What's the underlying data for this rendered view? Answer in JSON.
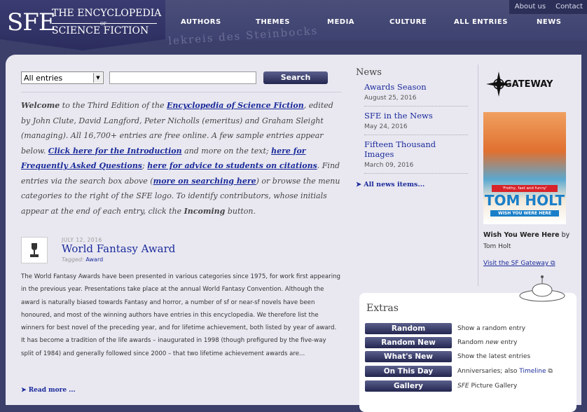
{
  "header": {
    "logo": {
      "sfe": "SFE",
      "line1": "THE ENCYCLOPEDIA",
      "of": "OF",
      "line2": "SCIENCE FICTION"
    },
    "top_links": [
      "About us",
      "Contact"
    ],
    "nav": [
      "AUTHORS",
      "THEMES",
      "MEDIA",
      "CULTURE",
      "ALL ENTRIES",
      "NEWS"
    ],
    "ghost_text": "lekreis des Steinbocks"
  },
  "search": {
    "select_value": "All entries",
    "query": "",
    "button": "Search"
  },
  "welcome": {
    "w1": "Welcome",
    "t1": " to the Third Edition of the ",
    "link_esf": "Encyclopedia of Science Fiction",
    "t2": ", edited by John Clute, David Langford, Peter Nicholls (emeritus) and Graham Sleight (managing). All 16,700+ entries are free online. A few sample entries appear below. ",
    "link_intro": "Click here for the Introduction",
    "t3": " and more on the text; ",
    "link_faq": "here for Frequently Asked Questions",
    "t4": "; ",
    "link_students": "here for advice to students on citations",
    "t5": ". Find entries via the search box above (",
    "link_search": "more on searching here",
    "t6": ") or browse the menu categories to the right of the SFE logo. To identify contributors, whose initials appear at the end of each entry, click the ",
    "incoming": "Incoming",
    "t7": " button."
  },
  "article": {
    "date": "JULY 12, 2016",
    "title": "World Fantasy Award",
    "tagged_label": "Tagged: ",
    "tag": "Award",
    "body": "The World Fantasy Awards have been presented in various categories since 1975, for work first appearing in the previous year. Presentations take place at the annual World Fantasy Convention. Although the award is naturally biased towards Fantasy and horror, a number of sf or near-sf novels have been honoured, and most of the winning authors have entries in this encyclopedia. We therefore list the winners for best novel of the preceding year, and for lifetime achievement, both listed by year of award. It has become a tradition of the life awards – inaugurated in 1998 (though prefigured by the five-way split of 1984) and generally followed since 2000 – that two lifetime achievement awards are...",
    "read_more": "Read more ..."
  },
  "news": {
    "heading": "News",
    "items": [
      {
        "title": "Awards Season",
        "date": "August 25, 2016"
      },
      {
        "title": "SFE in the News",
        "date": "May 24, 2016"
      },
      {
        "title": "Fifteen Thousand Images",
        "date": "March 09, 2016"
      }
    ],
    "all_items": "All news items..."
  },
  "gateway": {
    "logo_text": "GATEWAY",
    "cover_blurb": "'Frothy, fast and funny'",
    "cover_author": "TOM HOLT",
    "cover_subtitle": "WISH YOU WERE HERE",
    "book_title": "Wish You Were Here",
    "by": " by",
    "author": "Tom Holt",
    "link": "Visit the SF Gateway"
  },
  "extras": {
    "heading": "Extras",
    "rows": [
      {
        "button": "Random",
        "desc": "Show a random entry"
      },
      {
        "button": "Random New",
        "desc_pre": "Random ",
        "desc_em": "new",
        "desc_post": " entry"
      },
      {
        "button": "What's New",
        "desc": "Show the latest entries"
      },
      {
        "button": "On This Day",
        "desc_pre": "Anniversaries; also ",
        "desc_link": "Timeline"
      },
      {
        "button": "Gallery",
        "desc_em": "SFE",
        "desc_post": " Picture Gallery"
      }
    ]
  }
}
